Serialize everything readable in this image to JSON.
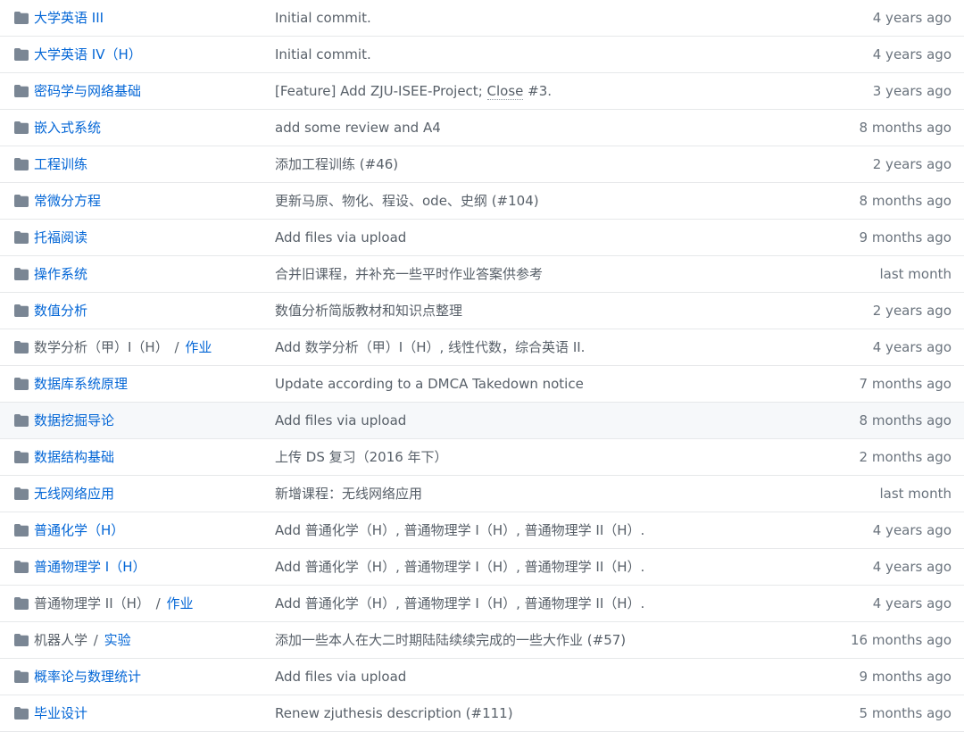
{
  "icon_color": "#79b8ff",
  "link_color": "#0366d6",
  "folder_icon_name": "folder-icon",
  "rows": [
    {
      "name": "大学英语 III",
      "message": "Initial commit.",
      "age": "4 years ago"
    },
    {
      "name": "大学英语 IV（H）",
      "message": "Initial commit.",
      "age": "4 years ago"
    },
    {
      "name": "密码学与网络基础",
      "message": "[Feature] Add ZJU-ISEE-Project; ",
      "message_link": "Close",
      "message_suffix": " #3.",
      "age": "3 years ago"
    },
    {
      "name": "嵌入式系统",
      "message": "add some review and A4",
      "age": "8 months ago"
    },
    {
      "name": "工程训练",
      "message": "添加工程训练 (#46)",
      "age": "2 years ago"
    },
    {
      "name": "常微分方程",
      "message": "更新马原、物化、程设、ode、史纲 (#104)",
      "age": "8 months ago"
    },
    {
      "name": "托福阅读",
      "message": "Add files via upload",
      "age": "9 months ago"
    },
    {
      "name": "操作系统",
      "message": "合并旧课程，并补充一些平时作业答案供参考",
      "age": "last month"
    },
    {
      "name": "数值分析",
      "message": "数值分析简版教材和知识点整理",
      "age": "2 years ago"
    },
    {
      "name_prefix": "数学分析（甲）I（H）",
      "name_sep": "/",
      "name": "作业",
      "message": "Add 数学分析（甲）I（H）, 线性代数，综合英语 II.",
      "age": "4 years ago"
    },
    {
      "name": "数据库系统原理",
      "message": "Update according to a DMCA Takedown notice",
      "age": "7 months ago"
    },
    {
      "name": "数据挖掘导论",
      "message": "Add files via upload",
      "age": "8 months ago",
      "highlight": true
    },
    {
      "name": "数据结构基础",
      "message": "上传 DS 复习（2016 年下）",
      "age": "2 months ago"
    },
    {
      "name": "无线网络应用",
      "message": "新增课程：无线网络应用",
      "age": "last month"
    },
    {
      "name": "普通化学（H）",
      "message": "Add 普通化学（H）, 普通物理学 I（H）, 普通物理学 II（H）.",
      "age": "4 years ago"
    },
    {
      "name": "普通物理学 I（H）",
      "message": "Add 普通化学（H）, 普通物理学 I（H）, 普通物理学 II（H）.",
      "age": "4 years ago"
    },
    {
      "name_prefix": "普通物理学 II（H）",
      "name_sep": "/",
      "name": "作业",
      "message": "Add 普通化学（H）, 普通物理学 I（H）, 普通物理学 II（H）.",
      "age": "4 years ago"
    },
    {
      "name_prefix": "机器人学",
      "name_sep": "/",
      "name": "实验",
      "message": "添加一些本人在大二时期陆陆续续完成的一些大作业 (#57)",
      "age": "16 months ago"
    },
    {
      "name": "概率论与数理统计",
      "message": "Add files via upload",
      "age": "9 months ago"
    },
    {
      "name": "毕业设计",
      "message": "Renew zjuthesis description (#111)",
      "age": "5 months ago"
    }
  ]
}
